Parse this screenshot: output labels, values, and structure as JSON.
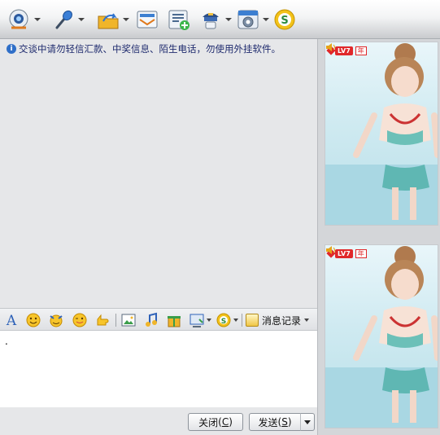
{
  "toolbar": {
    "items": [
      {
        "icon": "video-call-icon",
        "has_menu": true
      },
      {
        "icon": "microphone-icon",
        "has_menu": true
      },
      {
        "icon": "send-file-icon",
        "has_menu": true
      },
      {
        "icon": "email-icon",
        "has_menu": false
      },
      {
        "icon": "create-group-icon",
        "has_menu": false
      },
      {
        "icon": "remote-assist-icon",
        "has_menu": true
      },
      {
        "icon": "app-settings-icon",
        "has_menu": true
      },
      {
        "icon": "soso-icon",
        "has_menu": false
      }
    ]
  },
  "chat": {
    "notice": "交谈中请勿轻信汇款、中奖信息、陌生电话，勿使用外挂软件。",
    "input_value": "."
  },
  "format_bar": {
    "icons": [
      "font-icon",
      "emoticon-icon",
      "magic-emoticon-icon",
      "wink-icon",
      "shake-window-icon",
      "image-icon",
      "music-icon",
      "gift-icon",
      "screenshot-icon",
      "soso-search-icon"
    ],
    "history_label": "消息记录"
  },
  "buttons": {
    "close_label": "关闭",
    "close_hotkey": "C",
    "send_label": "发送",
    "send_hotkey": "S"
  },
  "side": {
    "level_badge": "LV7",
    "year_tag": "年",
    "colors": {
      "accent": "#e0282a",
      "toolbar_blue": "#2f6fc8"
    }
  }
}
